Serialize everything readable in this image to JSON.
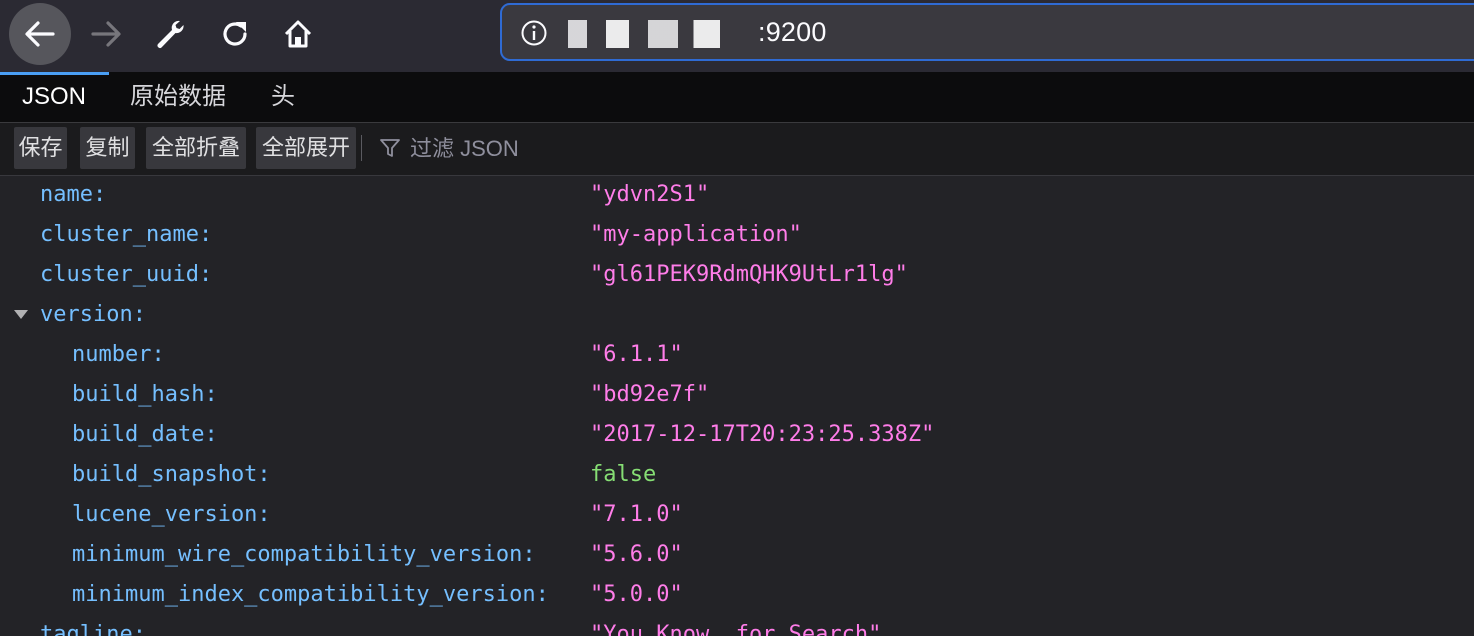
{
  "browser": {
    "url_visible_suffix": ":9200",
    "url_prefix_partial": "",
    "url_glyphs_masked": "........"
  },
  "viewer": {
    "tabs": [
      {
        "label": "JSON",
        "active": true
      },
      {
        "label": "原始数据",
        "active": false
      },
      {
        "label": "头",
        "active": false
      }
    ],
    "actions": {
      "save": "保存",
      "copy": "复制",
      "collapse_all": "全部折叠",
      "expand_all": "全部展开",
      "filter_placeholder": "过滤 JSON"
    }
  },
  "json_rows": [
    {
      "key": "name:",
      "value": "\"ydvn2S1\"",
      "type": "string"
    },
    {
      "key": "cluster_name:",
      "value": "\"my-application\"",
      "type": "string"
    },
    {
      "key": "cluster_uuid:",
      "value": "\"gl61PEK9RdmQHK9UtLr1lg\"",
      "type": "string"
    },
    {
      "key": "version:",
      "value": "",
      "type": "object",
      "expanded": true
    },
    {
      "key": "number:",
      "value": "\"6.1.1\"",
      "type": "string"
    },
    {
      "key": "build_hash:",
      "value": "\"bd92e7f\"",
      "type": "string"
    },
    {
      "key": "build_date:",
      "value": "\"2017-12-17T20:23:25.338Z\"",
      "type": "string"
    },
    {
      "key": "build_snapshot:",
      "value": "false",
      "type": "boolean"
    },
    {
      "key": "lucene_version:",
      "value": "\"7.1.0\"",
      "type": "string"
    },
    {
      "key": "minimum_wire_compatibility_version:",
      "value": "\"5.6.0\"",
      "type": "string"
    },
    {
      "key": "minimum_index_compatibility_version:",
      "value": "\"5.0.0\"",
      "type": "string"
    },
    {
      "key": "tagline:",
      "value": "\"You Know, for Search\"",
      "type": "string"
    }
  ],
  "colors": {
    "key": "#75bfff",
    "string": "#ff7de9",
    "boolean": "#86de74",
    "accent": "#4a9ff5",
    "urlbar_border": "#2f6bd4"
  }
}
